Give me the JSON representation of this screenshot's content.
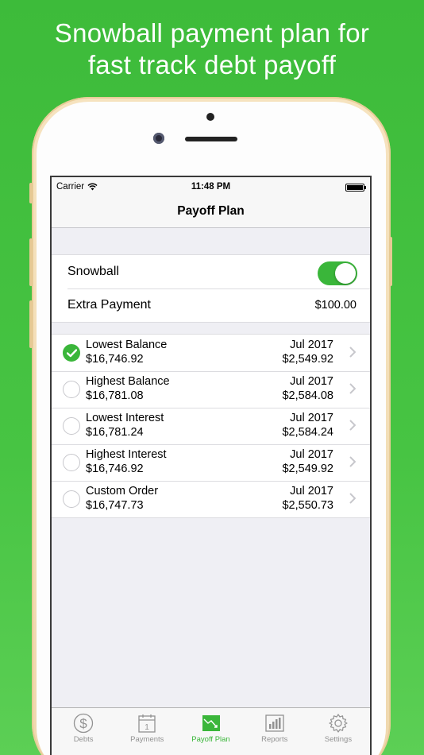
{
  "headline": {
    "line1": "Snowball payment plan for",
    "line2": "fast track debt payoff"
  },
  "status_bar": {
    "carrier": "Carrier",
    "time": "11:48 PM"
  },
  "nav": {
    "title": "Payoff Plan"
  },
  "settings": {
    "snowball_label": "Snowball",
    "snowball_on": true,
    "extra_payment_label": "Extra Payment",
    "extra_payment_value": "$100.00"
  },
  "plans": [
    {
      "name": "Lowest Balance",
      "total": "$16,746.92",
      "date": "Jul 2017",
      "payment": "$2,549.92",
      "selected": true
    },
    {
      "name": "Highest Balance",
      "total": "$16,781.08",
      "date": "Jul 2017",
      "payment": "$2,584.08",
      "selected": false
    },
    {
      "name": "Lowest Interest",
      "total": "$16,781.24",
      "date": "Jul 2017",
      "payment": "$2,584.24",
      "selected": false
    },
    {
      "name": "Highest Interest",
      "total": "$16,746.92",
      "date": "Jul 2017",
      "payment": "$2,549.92",
      "selected": false
    },
    {
      "name": "Custom Order",
      "total": "$16,747.73",
      "date": "Jul 2017",
      "payment": "$2,550.73",
      "selected": false
    }
  ],
  "tabs": [
    {
      "label": "Debts",
      "icon": "dollar-icon",
      "active": false
    },
    {
      "label": "Payments",
      "icon": "calendar-icon",
      "active": false
    },
    {
      "label": "Payoff Plan",
      "icon": "trend-down-icon",
      "active": true
    },
    {
      "label": "Reports",
      "icon": "bar-chart-icon",
      "active": false
    },
    {
      "label": "Settings",
      "icon": "gear-icon",
      "active": false
    }
  ],
  "colors": {
    "accent": "#3ab63a",
    "background_green": "#47c443"
  }
}
